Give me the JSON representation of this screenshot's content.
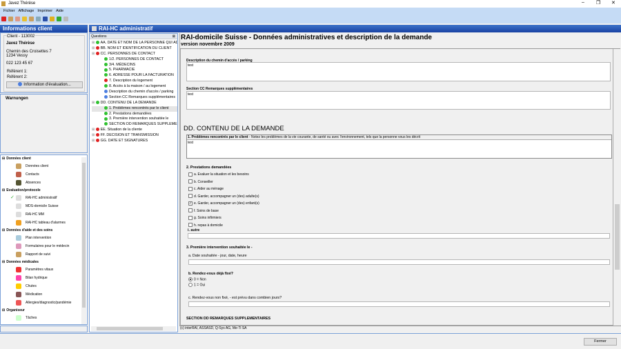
{
  "window": {
    "title": "Javez Thérèse"
  },
  "menu": [
    "Fichier",
    "Affichage",
    "Imprimer",
    "Aide"
  ],
  "client_panel": {
    "header": "Informations client",
    "client_id": "Client - 113002",
    "name": "Javez Thérèse",
    "address1": "Chemin des Croisettes 7",
    "address2": "1234 Vessy",
    "phone": "022 123 45 67",
    "referent1": "Référent 1:",
    "referent2": "Référent 2:",
    "info_button": "Information d'évaluation...",
    "warnings": "Warnungen"
  },
  "nav": [
    {
      "section": "Données client",
      "items": [
        "Données client",
        "Contacts",
        "Absences"
      ]
    },
    {
      "section": "Evaluation/protocole",
      "items": [
        "RAI-HC administratif",
        "MDS-domicile Suisse",
        "RAI-HC MM",
        "RAI-HC tableau d'alarmes"
      ]
    },
    {
      "section": "Données d'aide et des soins",
      "items": [
        "Plan intervention",
        "Formulaires pour le médecin",
        "Rapport de suivi"
      ]
    },
    {
      "section": "Données médicales",
      "items": [
        "Paramètres vitaux",
        "Bilan hydrique",
        "Chutes",
        "Médication",
        "Allergies/diagnostic/pandémie"
      ]
    },
    {
      "section": "Organiseur",
      "items": [
        "Tâches"
      ]
    }
  ],
  "nav_checked": "RAI-HC administratif",
  "module": {
    "header": "RAI-HC administratif",
    "questions_label": "Questions"
  },
  "tree": [
    {
      "label": "AA. DATE ET NOM DE LA PERSONNE QUI AD",
      "status": "green",
      "level": 0
    },
    {
      "label": "BB. NOM ET IDENTIFICATION DU CLIENT",
      "status": "red",
      "level": 0
    },
    {
      "label": "CC. PERSONNES DE CONTACT",
      "status": "red",
      "level": 0
    },
    {
      "label": "1/2. PERSONNES DE CONTACT",
      "status": "green",
      "level": 1
    },
    {
      "label": "3/4. MÉDECINS",
      "status": "green",
      "level": 1
    },
    {
      "label": "5. PHARMACIE",
      "status": "green",
      "level": 1
    },
    {
      "label": "6. ADRESSE POUR LA FACTURATION",
      "status": "green",
      "level": 1
    },
    {
      "label": "7. Description du logement",
      "status": "red",
      "level": 1
    },
    {
      "label": "8. Accès à la maison / au logement",
      "status": "green",
      "level": 1
    },
    {
      "label": "Description du chemin d'accès / parking",
      "status": "blue",
      "level": 1
    },
    {
      "label": "Section CC Remarques supplémentaires",
      "status": "blue",
      "level": 1
    },
    {
      "label": "DD. CONTENU DE LA DEMANDE",
      "status": "green",
      "level": 0
    },
    {
      "label": "1. Problèmes rencontrés par le client",
      "status": "green",
      "level": 1
    },
    {
      "label": "2. Prestations demandées",
      "status": "green",
      "level": 1
    },
    {
      "label": "3. Première intervention souhaitée le",
      "status": "green",
      "level": 1
    },
    {
      "label": "SECTION DD REMARQUES SUPPLEMENT",
      "status": "green",
      "level": 1
    },
    {
      "label": "EE. Situation de la cliente",
      "status": "red",
      "level": 0
    },
    {
      "label": "FF. DECISION ET TRANSMISSION",
      "status": "red",
      "level": 0
    },
    {
      "label": "GG. DATE ET SIGNATURES",
      "status": "red",
      "level": 0
    }
  ],
  "form": {
    "title": "RAI-domicile Suisse - Données administratives et description de la demande",
    "version": "version novembre 2009",
    "access_label": "Description du chemin d'accès / parking",
    "access_value": "test",
    "cc_label": "Section CC Remarques supplémentaires",
    "cc_value": "test",
    "dd_title": "DD. CONTENU DE LA DEMANDE",
    "q1_label": "1. Problèmes rencontrés par le client",
    "q1_hint": " - Notez les problèmes de la vie courante, de santé ou avec l'environnement, tels que la personne vous les décrit",
    "q1_value": "test",
    "q2_label": "2. Prestations demandées",
    "q2_options": [
      {
        "label": "a. Evaluer la situation et les besoins",
        "checked": false
      },
      {
        "label": "b. Conseiller",
        "checked": false
      },
      {
        "label": "c. Aider au ménage",
        "checked": false
      },
      {
        "label": "d. Garder, accompagner un (des) adulte(s)",
        "checked": false
      },
      {
        "label": "e. Garder, accompagner un (des) enfant(s)",
        "checked": true
      },
      {
        "label": "f. Soins de base",
        "checked": false
      },
      {
        "label": "g. Soins infirmiers",
        "checked": false
      },
      {
        "label": "h. repas à domicile",
        "checked": false
      }
    ],
    "q2_other": "i. autre",
    "q3_label": "3. Première intervention souhaitée le -",
    "q3a_label": "a. Date souhaitée",
    "q3a_hint": " - jour, date, heure",
    "q3b_label": "b. Rendez-vous déjà fixé?",
    "q3b_options": [
      {
        "label": "0 = Non",
        "selected": true
      },
      {
        "label": "1 = Oui",
        "selected": false
      }
    ],
    "q3c_label": "c. Rendez-vous non fixé,",
    "q3c_hint": " - est prévu dans combien jours?",
    "dd_remarks": "SECTION DD REMARQUES SUPPLEMENTAIRES",
    "copyright": "(c) interRAI, ASSASD, Q-Sys AG, Me-Ti SA"
  },
  "footer": {
    "close_button": "Fermer"
  },
  "colors": {
    "header_blue": "#1842a3",
    "menu_bg": "#c5dbf5",
    "status_green": "#2fc12f",
    "status_red": "#e02020"
  }
}
